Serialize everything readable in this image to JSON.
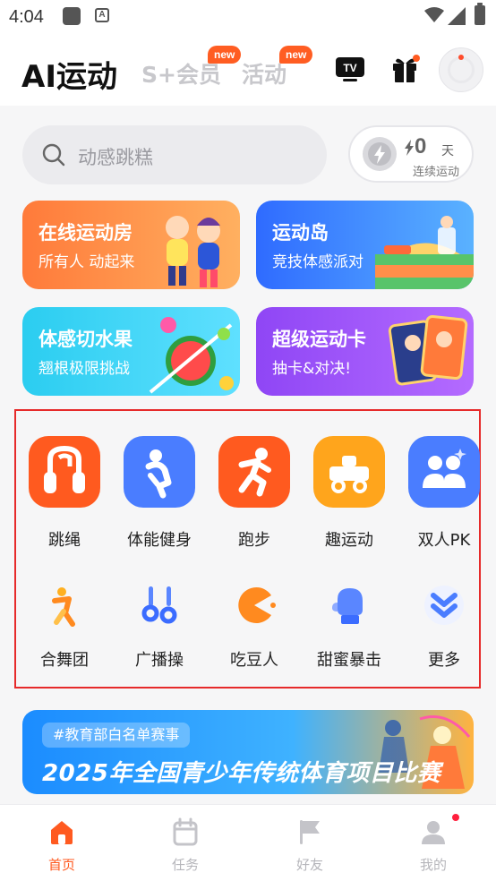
{
  "status_bar": {
    "time": "4:04",
    "badge_letter": "A"
  },
  "header": {
    "title": "AI运动",
    "tabs": [
      {
        "label": "S+会员",
        "badge": "new"
      },
      {
        "label": "活动",
        "badge": "new"
      }
    ],
    "tv_label": "TV"
  },
  "search": {
    "placeholder": "动感跳糕"
  },
  "streak": {
    "count": "0",
    "unit": "天",
    "label": "连续运动"
  },
  "cards": [
    {
      "title": "在线运动房",
      "subtitle": "所有人 动起来"
    },
    {
      "title": "运动岛",
      "subtitle": "竞技体感派对"
    },
    {
      "title": "体感切水果",
      "subtitle": "翘根极限挑战"
    },
    {
      "title": "超级运动卡",
      "subtitle": "抽卡&对决!"
    }
  ],
  "grid": {
    "row1": [
      {
        "label": "跳绳",
        "icon": "jump-rope-icon",
        "color": "#ff5a1f"
      },
      {
        "label": "体能健身",
        "icon": "fitness-icon",
        "color": "#4a7dff"
      },
      {
        "label": "跑步",
        "icon": "running-icon",
        "color": "#ff5a1f"
      },
      {
        "label": "趣运动",
        "icon": "fun-sport-icon",
        "color": "#ffa51c"
      },
      {
        "label": "双人PK",
        "icon": "two-person-pk-icon",
        "color": "#4a7dff"
      }
    ],
    "row2": [
      {
        "label": "合舞团",
        "icon": "dance-icon"
      },
      {
        "label": "广播操",
        "icon": "broadcast-exercise-icon"
      },
      {
        "label": "吃豆人",
        "icon": "pacman-icon"
      },
      {
        "label": "甜蜜暴击",
        "icon": "boxing-glove-icon"
      },
      {
        "label": "更多",
        "icon": "more-chevron-icon"
      }
    ]
  },
  "banner": {
    "tag": "#教育部白名单赛事",
    "title": "2025年全国青少年传统体育项目比赛"
  },
  "bottom_nav": [
    {
      "label": "首页",
      "icon": "home-icon",
      "active": true
    },
    {
      "label": "任务",
      "icon": "calendar-icon",
      "active": false
    },
    {
      "label": "好友",
      "icon": "flag-icon",
      "active": false
    },
    {
      "label": "我的",
      "icon": "profile-icon",
      "active": false
    }
  ],
  "colors": {
    "accent": "#ff5a20",
    "blue": "#4a7dff",
    "highlight_frame": "#e62a2a"
  }
}
